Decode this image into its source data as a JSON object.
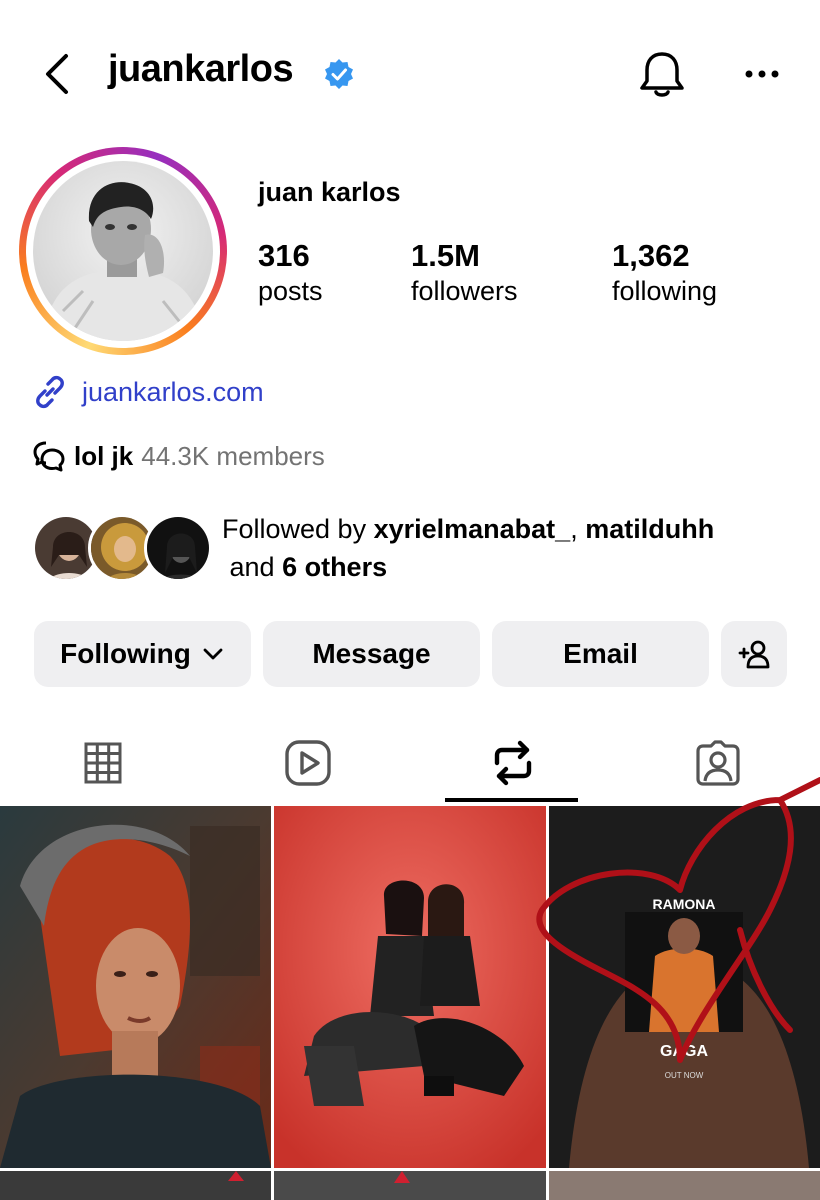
{
  "header": {
    "username": "juankarlos",
    "verified": true,
    "icons": [
      "chevron-left-icon",
      "verified-badge-icon",
      "bell-icon",
      "more-icon"
    ]
  },
  "profile": {
    "full_name": "juan karlos",
    "stats": [
      {
        "value": "316",
        "label": "posts"
      },
      {
        "value": "1.5M",
        "label": "followers"
      },
      {
        "value": "1,362",
        "label": "following"
      }
    ],
    "link": "juankarlos.com",
    "community": {
      "name": "lol jk",
      "members": "44.3K members"
    },
    "followed_by": {
      "prefix": "Followed by ",
      "user1": "xyrielmanabat_",
      "separator": ", ",
      "user2": "matilduhh",
      "and": " and ",
      "others": "6 others"
    }
  },
  "actions": {
    "following_label": "Following",
    "message_label": "Message",
    "email_label": "Email"
  },
  "tabs": [
    {
      "name": "grid",
      "icon": "grid-icon"
    },
    {
      "name": "reels",
      "icon": "reels-icon"
    },
    {
      "name": "reposts",
      "icon": "repost-icon",
      "active": true
    },
    {
      "name": "tagged",
      "icon": "tagged-icon"
    }
  ],
  "posts": {
    "post3_text_top": "RAMONA",
    "post3_text_mid": "GAGA",
    "post3_text_bottom": "OUT NOW"
  },
  "colors": {
    "link": "#3140c9",
    "verified": "#3797f0",
    "button_bg": "#efeff1",
    "annotation": "#b01018"
  }
}
